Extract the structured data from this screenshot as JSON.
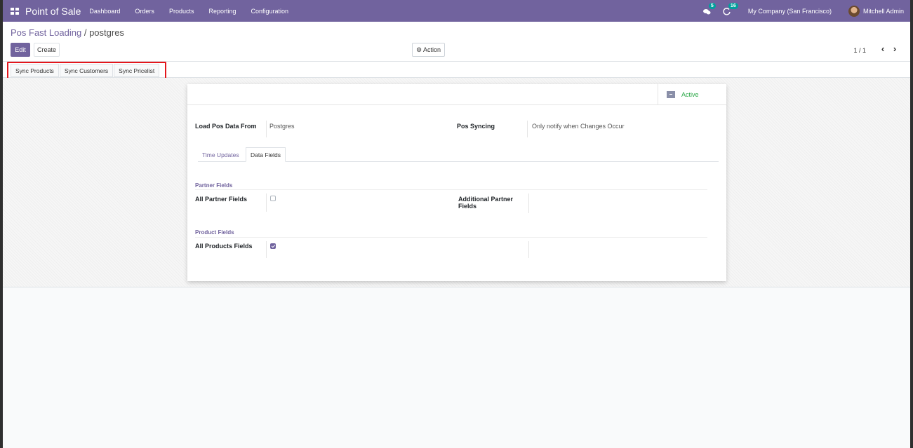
{
  "navbar": {
    "brand": "Point of Sale",
    "menu": [
      "Dashboard",
      "Orders",
      "Products",
      "Reporting",
      "Configuration"
    ],
    "messages_count": "5",
    "activities_count": "16",
    "company": "My Company (San Francisco)",
    "user": "Mitchell Admin"
  },
  "breadcrumb": {
    "parent": "Pos Fast Loading",
    "separator": "/",
    "current": "postgres"
  },
  "buttons": {
    "edit": "Edit",
    "create": "Create",
    "action": "Action"
  },
  "pager": {
    "text": "1 / 1"
  },
  "sync": {
    "products": "Sync Products",
    "customers": "Sync Customers",
    "pricelist": "Sync Pricelist"
  },
  "status": {
    "active": "Active"
  },
  "form": {
    "load_label": "Load Pos Data From",
    "load_value": "Postgres",
    "syncing_label": "Pos Syncing",
    "syncing_value": "Only notify when Changes Occur",
    "tabs": [
      "Time Updates",
      "Data Fields"
    ],
    "partner_group": "Partner Fields",
    "all_partner_label": "All Partner Fields",
    "all_partner_checked": false,
    "additional_partner_label_1": "Additional Partner",
    "additional_partner_label_2": "Fields",
    "product_group": "Product Fields",
    "all_products_label": "All Products Fields",
    "all_products_checked": true
  },
  "colors": {
    "primary": "#71639e",
    "active": "#28a745",
    "highlight_border": "#e4161c"
  }
}
